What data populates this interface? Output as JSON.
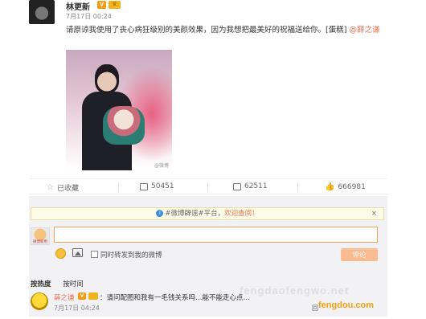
{
  "post": {
    "author": "林更新",
    "badge_v": "V",
    "badge_crown": "♛",
    "time": "7月17日 00:24",
    "text": "请原谅我使用了丧心病狂级别的美颜效果，因为我想把最美好的祝福送给你。[蛋糕] ",
    "mention": "@薛之谦",
    "image_watermark": "@微博"
  },
  "actions": {
    "favorite": "已收藏",
    "repost": "50451",
    "comment": "62511",
    "like": "666981"
  },
  "comment_box": {
    "notice_prefix": "#微博辟谣#平台，",
    "notice_link": "欢迎查阅！",
    "notice_close": "×",
    "avatar_tag": "微博新用",
    "input_value": "",
    "repost_checkbox_label": "同时转发到我的微博",
    "submit_label": "评论"
  },
  "sort": {
    "hot": "按热度",
    "time": "按时间"
  },
  "comments": [
    {
      "name": "薛之谦",
      "badge_v": "V",
      "text": "：请问配图和我有一毛钱关系吗…能不能走心点…",
      "time": "7月17日 04:24",
      "reply": "回"
    }
  ],
  "watermarks": {
    "faint": "fengdaofengwo.net",
    "brand": "fengdou.com"
  },
  "colors": {
    "accent": "#eb7350",
    "input_border": "#eda35a",
    "submit_bg": "#f9bb8f",
    "verified": "#f79a0f"
  }
}
